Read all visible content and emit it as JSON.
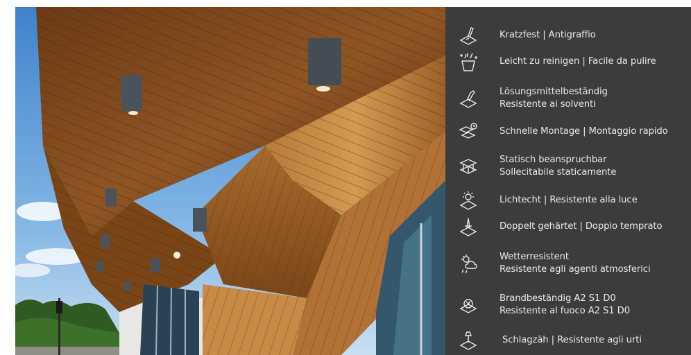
{
  "features": [
    {
      "icon": "scratch-resistant-icon",
      "lines": [
        "Kratzfest | Antigraffio"
      ]
    },
    {
      "icon": "easy-clean-icon",
      "lines": [
        "Leicht zu reinigen | Facile da pulire"
      ]
    },
    {
      "icon": "solvent-resistant-icon",
      "lines": [
        "Lösungsmittelbeständig",
        "Resistente ai solventi"
      ]
    },
    {
      "icon": "quick-assembly-icon",
      "lines": [
        "Schnelle Montage | Montaggio rapido"
      ]
    },
    {
      "icon": "load-bearing-icon",
      "lines": [
        "Statisch beanspruchbar",
        "Sollecitabile staticamente"
      ]
    },
    {
      "icon": "lightfast-icon",
      "lines": [
        "Lichtecht | Resistente alla luce"
      ]
    },
    {
      "icon": "double-hardened-icon",
      "lines": [
        "Doppelt gehärtet | Doppio temprato"
      ]
    },
    {
      "icon": "weather-resistant-icon",
      "lines": [
        "Wetterresistent",
        "Resistente agli agenti atmosferici"
      ]
    },
    {
      "icon": "fire-resistant-icon",
      "lines": [
        "Brandbeständig A2 S1 D0",
        "Resistente al fuoco A2 S1 D0"
      ]
    },
    {
      "icon": "impact-resistant-icon",
      "lines": [
        "Schlagzäh | Resistente agli urti"
      ]
    }
  ],
  "colors": {
    "panel": "#3c3c3b",
    "text": "#e9e9e9",
    "wood": "#8a5326",
    "sky": "#4f8fd0"
  }
}
